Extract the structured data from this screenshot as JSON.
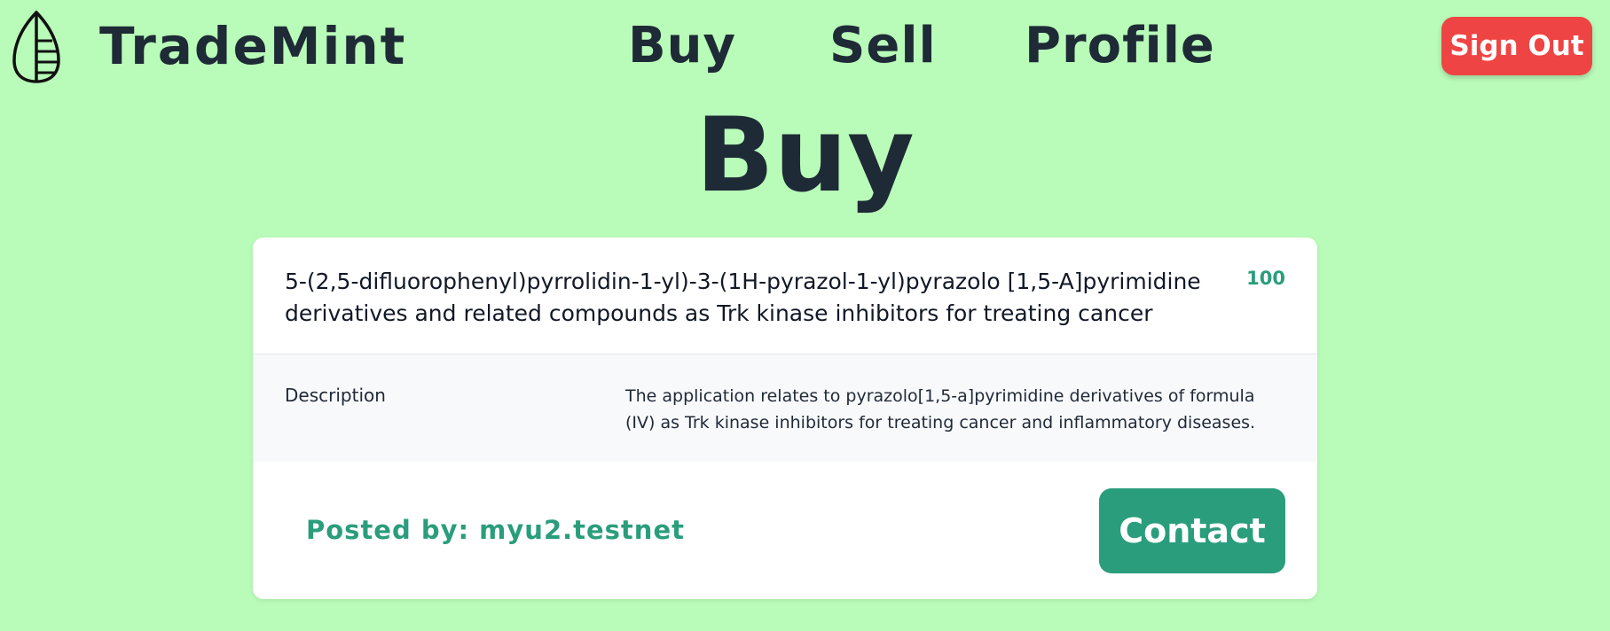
{
  "header": {
    "brand": "TradeMint",
    "nav": [
      {
        "label": "Buy"
      },
      {
        "label": "Sell"
      },
      {
        "label": "Profile"
      }
    ],
    "signout_label": "Sign Out",
    "logo_icon": "leaf-icon"
  },
  "page": {
    "title": "Buy"
  },
  "listing": {
    "title": "5-(2,5-difluorophenyl)pyrrolidin-1-yl)-3-(1H-pyrazol-1-yl)pyrazolo [1,5-A]pyrimidine derivatives and related compounds as Trk kinase inhibitors for treating cancer",
    "price": "100",
    "description_label": "Description",
    "description": "The application relates to pyrazolo[1,5-a]pyrimidine derivatives of formula (IV) as Trk kinase inhibitors for treating cancer and inflammatory diseases.",
    "posted_by": "Posted by: myu2.testnet",
    "contact_label": "Contact"
  },
  "colors": {
    "background": "#b9fbb8",
    "accent": "#2a9d7c",
    "signout": "#ef4444",
    "text": "#1e2a36"
  }
}
